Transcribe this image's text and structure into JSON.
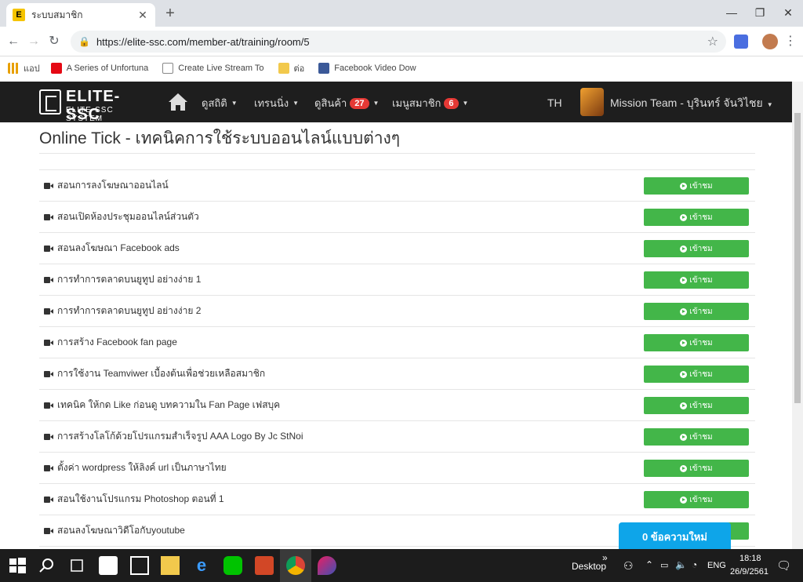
{
  "browser": {
    "tab_title": "ระบบสมาชิก",
    "favicon": "E",
    "url": "https://elite-ssc.com/member-at/training/room/5",
    "bookmarks": [
      {
        "label": "แอป",
        "icon": "apps-icon",
        "color": "#e8a000"
      },
      {
        "label": "A Series of Unfortuna",
        "icon": "netflix-icon",
        "color": "#e50914"
      },
      {
        "label": "Create Live Stream To",
        "icon": "page-icon",
        "color": "#888888"
      },
      {
        "label": "ต่อ",
        "icon": "folder-icon",
        "color": "#f2c94c"
      },
      {
        "label": "Facebook Video Dow",
        "icon": "facebook-icon",
        "color": "#3b5998"
      }
    ]
  },
  "site": {
    "logo_main": "ELITE-SSC",
    "logo_sub": "ELITE-SSC SYSTEM",
    "menus": [
      {
        "label": "ดูสถิติ",
        "badge": null
      },
      {
        "label": "เทรนนิ่ง",
        "badge": null
      },
      {
        "label": "ดูสินค้า",
        "badge": "27"
      },
      {
        "label": "เมนูสมาชิก",
        "badge": "6"
      }
    ],
    "lang": "TH",
    "user_name": "Mission Team - บุรินทร์ จันวิไชย"
  },
  "page": {
    "title": "Online Tick - เทคนิคการใช้ระบบออนไลน์แบบต่างๆ",
    "watch_label": "เข้าชม",
    "lessons": [
      "สอนการลงโฆษณาออนไลน์",
      "สอนเปิดห้องประชุมออนไลน์ส่วนตัว",
      "สอนลงโฆษณา Facebook ads",
      "การทำการตลาดบนยูทูป อย่างง่าย 1",
      "การทำการตลาดบนยูทูป อย่างง่าย 2",
      "การสร้าง Facebook fan page",
      "การใช้งาน Teamviwer เบื้องต้นเพื่อช่วยเหลือสมาชิก",
      "เทคนิค ให้กด Like ก่อนดู บทความใน Fan Page เฟสบุค",
      "การสร้างโลโก้ด้วยโปรแกรมสำเร็จรูป AAA Logo By Jc StNoi",
      "ตั้งค่า wordpress ให้ลิงค์ url เป็นภาษาไทย",
      "สอนใช้งานโปรแกรม Photoshop ตอนที่ 1",
      "สอนลงโฆษณาวิดีโอกับyoutube"
    ],
    "chat_label": "0 ข้อความใหม่"
  },
  "taskbar": {
    "desktop_label": "Desktop",
    "lang": "ENG",
    "time": "18:18",
    "date": "26/9/2561"
  }
}
